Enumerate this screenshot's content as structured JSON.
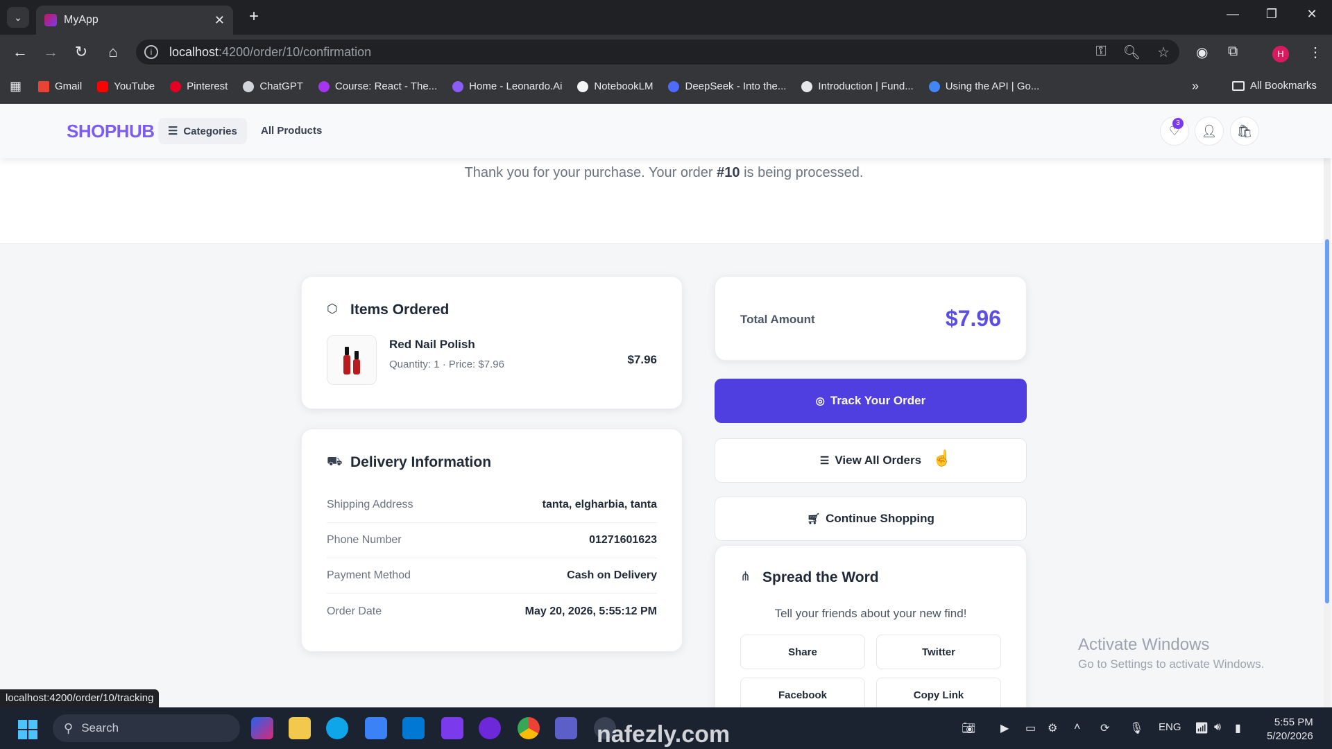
{
  "browser": {
    "tab_title": "MyApp",
    "url_host": "localhost",
    "url_path": ":4200/order/10/confirmation",
    "profile_initial": "H",
    "bookmarks": [
      "Gmail",
      "YouTube",
      "Pinterest",
      "ChatGPT",
      "Course: React - The...",
      "Home - Leonardo.Ai",
      "NotebookLM",
      "DeepSeek - Into the...",
      "Introduction | Fund...",
      "Using the API | Go..."
    ],
    "all_bookmarks": "All Bookmarks"
  },
  "header": {
    "logo": "SHOPHUB",
    "categories": "Categories",
    "all_products": "All Products",
    "wishlist_count": "3"
  },
  "confirmation": {
    "message_prefix": "Thank you for your purchase. Your order ",
    "order_ref": "#10",
    "message_suffix": " is being processed."
  },
  "items_ordered": {
    "title": "Items Ordered",
    "items": [
      {
        "name": "Red Nail Polish",
        "meta": "Quantity: 1 · Price: $7.96",
        "price": "$7.96"
      }
    ]
  },
  "delivery": {
    "title": "Delivery Information",
    "rows": [
      {
        "label": "Shipping Address",
        "value": "tanta, elgharbia, tanta"
      },
      {
        "label": "Phone Number",
        "value": "01271601623"
      },
      {
        "label": "Payment Method",
        "value": "Cash on Delivery"
      },
      {
        "label": "Order Date",
        "value": "May 20, 2026, 5:55:12 PM"
      }
    ]
  },
  "summary": {
    "total_label": "Total Amount",
    "total_value": "$7.96",
    "track_label": "Track Your Order",
    "view_orders_label": "View All Orders",
    "continue_label": "Continue Shopping"
  },
  "spread": {
    "title": "Spread the Word",
    "subtitle": "Tell your friends about your new find!",
    "buttons": [
      "Share",
      "Twitter",
      "Facebook",
      "Copy Link"
    ]
  },
  "overlays": {
    "status_url": "localhost:4200/order/10/tracking",
    "activate_title": "Activate Windows",
    "activate_sub": "Go to Settings to activate Windows.",
    "watermark": "nafezly.com"
  },
  "taskbar": {
    "search_placeholder": "Search",
    "lang": "ENG",
    "time": "5:55 PM",
    "date": "5/20/2026"
  },
  "colors": {
    "brand": "#7c5cf4",
    "primary_button": "#4f3fe0",
    "total_amount": "#5b4ee6"
  }
}
